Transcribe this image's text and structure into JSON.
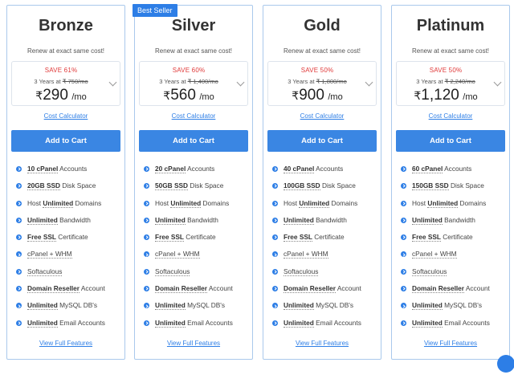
{
  "plans": [
    {
      "name": "Bronze",
      "badge": "",
      "renew": "Renew at exact same cost!",
      "save": "SAVE 61%",
      "years": "3 Years at",
      "old_price": "₹ 750/mo",
      "currency": "₹",
      "price": "290",
      "per": "/mo",
      "calculator": "Cost Calculator",
      "cta": "Add to Cart",
      "features": [
        {
          "b": "10 cPanel",
          "t": " Accounts"
        },
        {
          "b": "20GB SSD",
          "t": " Disk Space"
        },
        {
          "pre": "Host ",
          "b": "Unlimited",
          "t": " Domains"
        },
        {
          "b": "Unlimited",
          "t": " Bandwidth"
        },
        {
          "b": "Free SSL",
          "t": " Certificate"
        },
        {
          "pre": "",
          "b": "",
          "t": "cPanel + WHM"
        },
        {
          "pre": "",
          "b": "",
          "t": "Softaculous"
        },
        {
          "b": "Domain Reseller",
          "t": " Account"
        },
        {
          "b": "Unlimited",
          "t": " MySQL DB's"
        },
        {
          "b": "Unlimited",
          "t": " Email Accounts"
        }
      ],
      "view_full": "View Full Features"
    },
    {
      "name": "Silver",
      "badge": "Best Seller",
      "renew": "Renew at exact same cost!",
      "save": "SAVE 60%",
      "years": "3 Years at",
      "old_price": "₹ 1,400/mo",
      "currency": "₹",
      "price": "560",
      "per": "/mo",
      "calculator": "Cost Calculator",
      "cta": "Add to Cart",
      "features": [
        {
          "b": "20 cPanel",
          "t": " Accounts"
        },
        {
          "b": "50GB SSD",
          "t": " Disk Space"
        },
        {
          "pre": "Host ",
          "b": "Unlimited",
          "t": " Domains"
        },
        {
          "b": "Unlimited",
          "t": " Bandwidth"
        },
        {
          "b": "Free SSL",
          "t": " Certificate"
        },
        {
          "pre": "",
          "b": "",
          "t": "cPanel + WHM"
        },
        {
          "pre": "",
          "b": "",
          "t": "Softaculous"
        },
        {
          "b": "Domain Reseller",
          "t": " Account"
        },
        {
          "b": "Unlimited",
          "t": " MySQL DB's"
        },
        {
          "b": "Unlimited",
          "t": " Email Accounts"
        }
      ],
      "view_full": "View Full Features"
    },
    {
      "name": "Gold",
      "badge": "",
      "renew": "Renew at exact same cost!",
      "save": "SAVE 50%",
      "years": "3 Years at",
      "old_price": "₹ 1,800/mo",
      "currency": "₹",
      "price": "900",
      "per": "/mo",
      "calculator": "Cost Calculator",
      "cta": "Add to Cart",
      "features": [
        {
          "b": "40 cPanel",
          "t": " Accounts"
        },
        {
          "b": "100GB SSD",
          "t": " Disk Space"
        },
        {
          "pre": "Host ",
          "b": "Unlimited",
          "t": " Domains"
        },
        {
          "b": "Unlimited",
          "t": " Bandwidth"
        },
        {
          "b": "Free SSL",
          "t": " Certificate"
        },
        {
          "pre": "",
          "b": "",
          "t": "cPanel + WHM"
        },
        {
          "pre": "",
          "b": "",
          "t": "Softaculous"
        },
        {
          "b": "Domain Reseller",
          "t": " Account"
        },
        {
          "b": "Unlimited",
          "t": " MySQL DB's"
        },
        {
          "b": "Unlimited",
          "t": " Email Accounts"
        }
      ],
      "view_full": "View Full Features"
    },
    {
      "name": "Platinum",
      "badge": "",
      "renew": "Renew at exact same cost!",
      "save": "SAVE 50%",
      "years": "3 Years at",
      "old_price": "₹ 2,240/mo",
      "currency": "₹",
      "price": "1,120",
      "per": "/mo",
      "calculator": "Cost Calculator",
      "cta": "Add to Cart",
      "features": [
        {
          "b": "60 cPanel",
          "t": " Accounts"
        },
        {
          "b": "150GB SSD",
          "t": " Disk Space"
        },
        {
          "pre": "Host ",
          "b": "Unlimited",
          "t": " Domains"
        },
        {
          "b": "Unlimited",
          "t": " Bandwidth"
        },
        {
          "b": "Free SSL",
          "t": " Certificate"
        },
        {
          "pre": "",
          "b": "",
          "t": "cPanel + WHM"
        },
        {
          "pre": "",
          "b": "",
          "t": "Softaculous"
        },
        {
          "b": "Domain Reseller",
          "t": " Account"
        },
        {
          "b": "Unlimited",
          "t": " MySQL DB's"
        },
        {
          "b": "Unlimited",
          "t": " Email Accounts"
        }
      ],
      "view_full": "View Full Features"
    }
  ],
  "colors": {
    "accent": "#3a86e3",
    "save": "#e03a3a",
    "border": "#aac9ec"
  },
  "icons": {
    "feature": "check-circle-icon",
    "dropdown": "chevron-down-icon",
    "chat": "chat-icon"
  }
}
